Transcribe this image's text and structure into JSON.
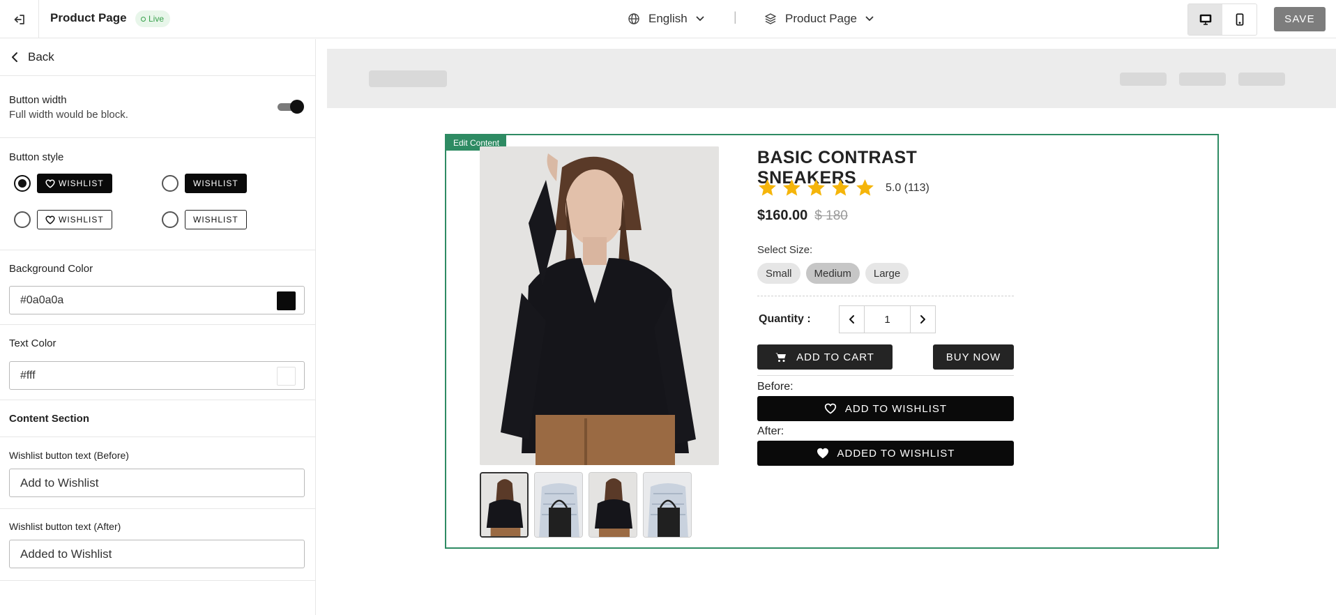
{
  "header": {
    "title": "Product Page",
    "status_badge": "Live",
    "language": "English",
    "separator": "|",
    "page_selector": "Product Page",
    "save_label": "SAVE",
    "active_device": "desktop"
  },
  "sidebar": {
    "back_label": "Back",
    "button_width": {
      "title": "Button width",
      "description": "Full width would be block.",
      "enabled": true
    },
    "button_style": {
      "title": "Button style",
      "options": [
        {
          "label": "WISHLIST",
          "variant": "filled-with-icon",
          "selected": true
        },
        {
          "label": "WISHLIST",
          "variant": "filled",
          "selected": false
        },
        {
          "label": "WISHLIST",
          "variant": "outline-with-icon",
          "selected": false
        },
        {
          "label": "WISHLIST",
          "variant": "outline",
          "selected": false
        }
      ]
    },
    "background_color": {
      "title": "Background Color",
      "value": "#0a0a0a"
    },
    "text_color": {
      "title": "Text Color",
      "value": "#fff"
    },
    "content_section_title": "Content Section",
    "wishlist_before": {
      "title": "Wishlist button text (Before)",
      "value": "Add to Wishlist"
    },
    "wishlist_after": {
      "title": "Wishlist button text (After)",
      "value": "Added to Wishlist"
    }
  },
  "preview": {
    "edit_tag": "Edit Content",
    "product": {
      "title": "BASIC CONTRAST SNEAKERS",
      "rating": 5,
      "rating_text": "5.0 (113)",
      "price": "$160.00",
      "old_price": "$ 180",
      "size_label": "Select Size:",
      "sizes": [
        {
          "label": "Small",
          "selected": false
        },
        {
          "label": "Medium",
          "selected": true
        },
        {
          "label": "Large",
          "selected": false
        }
      ],
      "quantity_label": "Quantity :",
      "quantity": "1",
      "add_to_cart": "ADD TO CART",
      "buy_now": "BUY NOW",
      "before_label": "Before:",
      "wishlist_before_btn": "ADD TO WISHLIST",
      "after_label": "After:",
      "wishlist_after_btn": "ADDED TO WISHLIST",
      "thumbnails": [
        "black-sweater-front",
        "striped-shirt-bag",
        "black-sweater-front",
        "striped-shirt-bag"
      ],
      "active_thumbnail": 1
    }
  },
  "colors": {
    "accent_green": "#2e8b63",
    "live_green": "#36a04a",
    "star_yellow": "#f5b50a",
    "button_dark": "#0a0a0a"
  }
}
